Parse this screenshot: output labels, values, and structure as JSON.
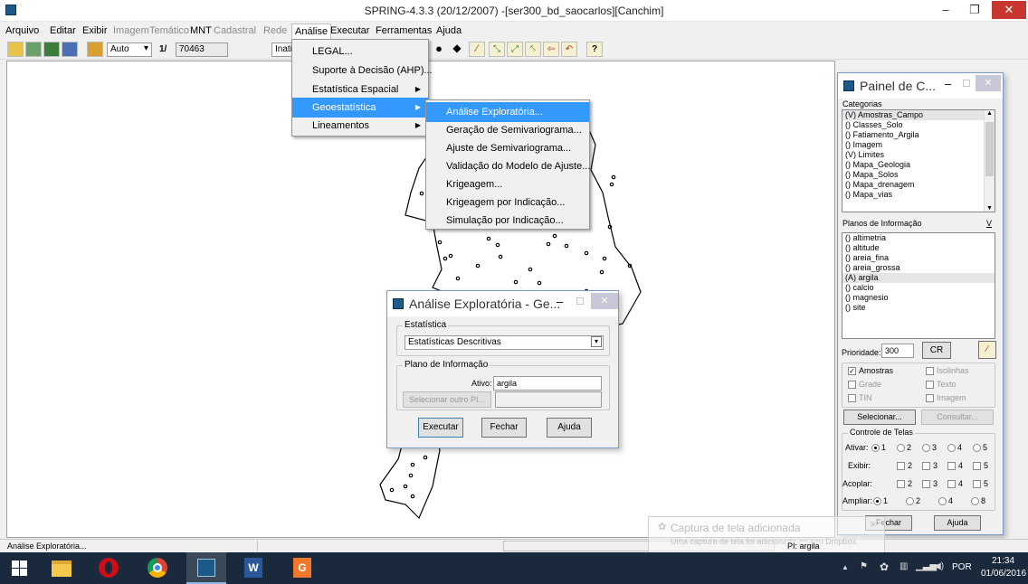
{
  "window": {
    "title": "SPRING-4.3.3 (20/12/2007) -[ser300_bd_saocarlos][Canchim]",
    "minimize": "–",
    "maximize": "❐",
    "close": "✕"
  },
  "menubar": {
    "items": [
      {
        "label": "Arquivo",
        "enabled": true
      },
      {
        "label": "Editar",
        "enabled": true
      },
      {
        "label": "Exibir",
        "enabled": true
      },
      {
        "label": "Imagem",
        "enabled": false
      },
      {
        "label": "Temático",
        "enabled": false
      },
      {
        "label": "MNT",
        "enabled": true
      },
      {
        "label": "Cadastral",
        "enabled": false
      },
      {
        "label": "Rede",
        "enabled": false
      },
      {
        "label": "Análise",
        "enabled": true,
        "open": true
      },
      {
        "label": "Executar",
        "enabled": true
      },
      {
        "label": "Ferramentas",
        "enabled": true
      },
      {
        "label": "Ajuda",
        "enabled": true
      }
    ]
  },
  "toolbar": {
    "mode": "Auto",
    "scale_prefix": "1/",
    "scale": "70463",
    "status_field": "Inativ"
  },
  "analise_menu": {
    "items": [
      {
        "label": "LEGAL...",
        "submenu": false
      },
      {
        "label": "Suporte à Decisão (AHP)...",
        "submenu": false
      },
      {
        "label": "Estatística Espacial",
        "submenu": true
      },
      {
        "label": "Geoestatística",
        "submenu": true,
        "selected": true
      },
      {
        "label": "Lineamentos",
        "submenu": true
      }
    ]
  },
  "geo_submenu": {
    "items": [
      {
        "label": "Análise Exploratória...",
        "selected": true
      },
      {
        "label": "Geração de Semivariograma..."
      },
      {
        "label": "Ajuste de Semivariograma..."
      },
      {
        "label": "Validação do Modelo de Ajuste..."
      },
      {
        "label": "Krigeagem..."
      },
      {
        "label": "Krigeagem por Indicação..."
      },
      {
        "label": "Simulação por Indicação..."
      }
    ]
  },
  "dialog": {
    "title": "Análise Exploratória - Ge...",
    "estatistica_label": "Estatística",
    "estatistica_value": "Estatísticas Descritivas",
    "plano_label": "Plano de Informação",
    "ativo_label": "Ativo:",
    "ativo_value": "argila",
    "select_other": "Selecionar outro PI...",
    "executar": "Executar",
    "fechar": "Fechar",
    "ajuda": "Ajuda"
  },
  "panel": {
    "title": "Painel de C...",
    "categorias_label": "Categorias",
    "categorias": [
      "(V) Amostras_Campo",
      "() Classes_Solo",
      "() Fatiamento_Argila",
      "() Imagem",
      "(V) Limites",
      "() Mapa_Geologia",
      "() Mapa_Solos",
      "() Mapa_drenagem",
      "() Mapa_vias"
    ],
    "planos_label": "Planos de Informação",
    "planos_v": "V",
    "planos": [
      "() altimetria",
      "() altitude",
      "() areia_fina",
      "() areia_grossa",
      "(A) argila",
      "() calcio",
      "() magnesio",
      "() site"
    ],
    "prioridade_label": "Prioridade:",
    "prioridade_value": "300",
    "cr": "CR",
    "checks": [
      {
        "label": "Amostras",
        "checked": true
      },
      {
        "label": "Isolinhas",
        "checked": false,
        "disabled": true
      },
      {
        "label": "Grade",
        "checked": false,
        "disabled": true
      },
      {
        "label": "Texto",
        "checked": false,
        "disabled": true
      },
      {
        "label": "TIN",
        "checked": false,
        "disabled": true
      },
      {
        "label": "Imagem",
        "checked": false,
        "disabled": true
      }
    ],
    "selecionar": "Selecionar...",
    "consultar": "Consultar...",
    "controle_label": "Controle de Telas",
    "ativar_label": "Ativar:",
    "exibir_label": "Exibir:",
    "acoplar_label": "Acoplar:",
    "ampliar_label": "Ampliar:",
    "ativar": [
      "1",
      "2",
      "3",
      "4",
      "5"
    ],
    "exibir": [
      "2",
      "3",
      "4",
      "5"
    ],
    "acoplar": [
      "2",
      "3",
      "4",
      "5"
    ],
    "ampliar": [
      "1",
      "2",
      "4",
      "8"
    ],
    "fechar": "Fechar",
    "ajuda": "Ajuda"
  },
  "status": {
    "left": "Análise Exploratória...",
    "pi": "PI: argila"
  },
  "toast": {
    "title": "Captura de tela adicionada",
    "body": "Uma captura de tela foi adicionada ao seu Dropbox."
  },
  "taskbar": {
    "lang": "POR",
    "time": "21:34",
    "date": "01/06/2016"
  }
}
